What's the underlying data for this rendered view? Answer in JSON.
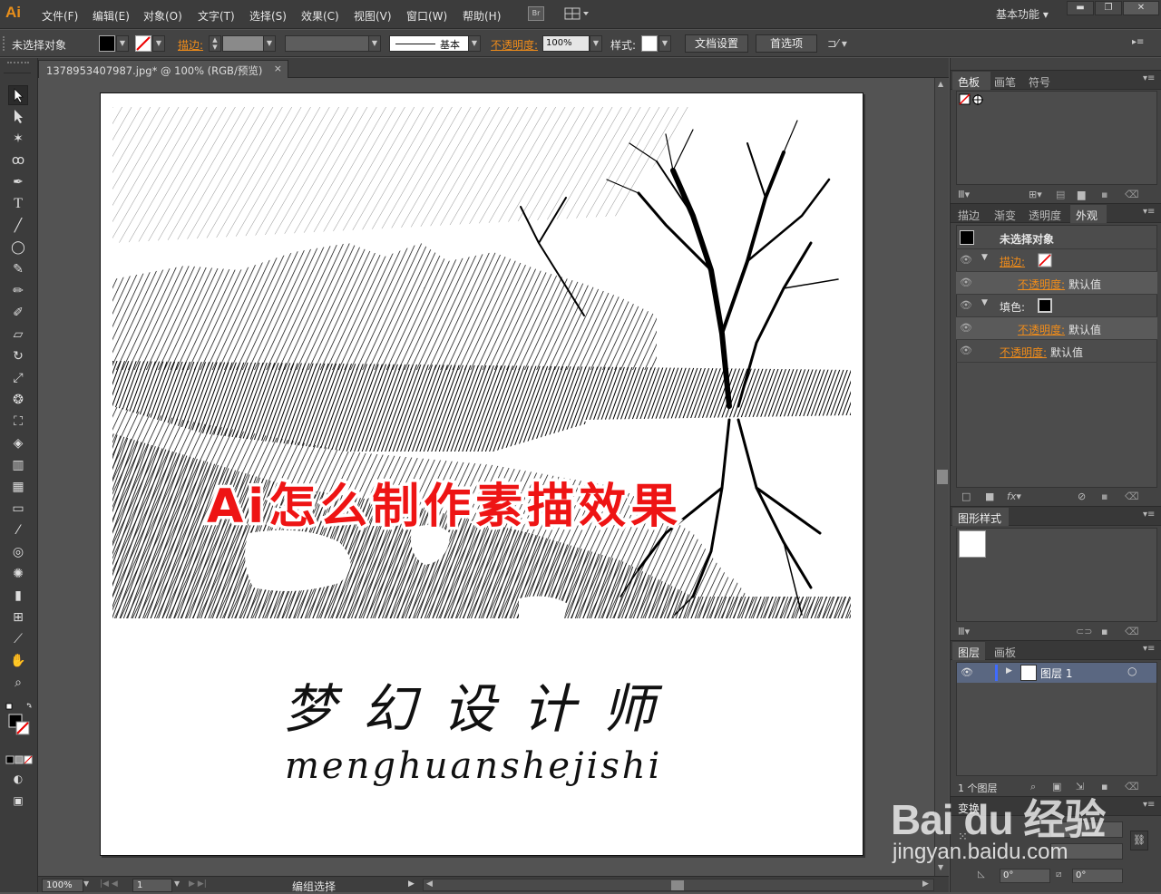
{
  "app": {
    "logo": "Ai"
  },
  "menu": [
    "文件(F)",
    "编辑(E)",
    "对象(O)",
    "文字(T)",
    "选择(S)",
    "效果(C)",
    "视图(V)",
    "窗口(W)",
    "帮助(H)"
  ],
  "br_label": "Br",
  "workspace": {
    "label": "基本功能",
    "arrow": "▾"
  },
  "window_buttons": {
    "minimize": "▬",
    "restore": "❐",
    "close": "✕"
  },
  "control": {
    "selection_label": "未选择对象",
    "stroke_label": "描边:",
    "stroke_profile": "基本",
    "opacity_label": "不透明度:",
    "opacity_value": "100%",
    "style_label": "样式:",
    "doc_setup": "文档设置",
    "preferences": "首选项"
  },
  "doc_tab": {
    "title": "1378953407987.jpg* @ 100% (RGB/预览)",
    "close": "×"
  },
  "artwork": {
    "overlay": "Ai怎么制作素描效果",
    "calligraphy": "梦幻设计师",
    "pinyin": "menghuanshejishi"
  },
  "status": {
    "zoom": "100%",
    "page": "1",
    "mode": "编组选择"
  },
  "panels": {
    "swatch_tabs": [
      "色板",
      "画笔",
      "符号"
    ],
    "appearance_tabs": [
      "描边",
      "渐变",
      "透明度",
      "外观"
    ],
    "appearance": {
      "title": "未选择对象",
      "stroke": "描边:",
      "opacity": "不透明度:",
      "default": "默认值",
      "fill": "填色:"
    },
    "graphic_styles_tab": "图形样式",
    "layers_tabs": [
      "图层",
      "画板"
    ],
    "layer_name": "图层 1",
    "layer_count": "1 个图层",
    "transform_tab": "变换",
    "transform_angle": "0°",
    "transform_shear": "0°"
  },
  "watermark": {
    "brand": "Bai du 经验",
    "url": "jingyan.baidu.com"
  }
}
